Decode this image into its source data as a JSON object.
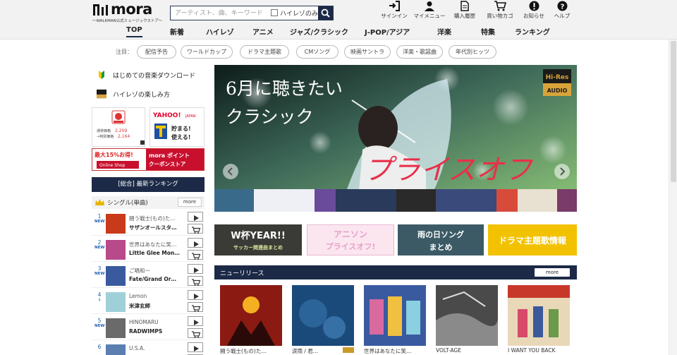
{
  "header": {
    "logo_text": "mora",
    "logo_tagline": "～WALKMAN公式ミュージックストア～",
    "search": {
      "placeholder": "アーティスト、曲、キーワード",
      "hires_only_label": "ハイレゾのみ"
    },
    "icons": [
      {
        "name": "signin-icon",
        "label": "サインイン"
      },
      {
        "name": "mymenu-icon",
        "label": "マイメニュー"
      },
      {
        "name": "history-icon",
        "label": "購入履歴"
      },
      {
        "name": "cart-icon",
        "label": "買い物カゴ"
      },
      {
        "name": "notice-icon",
        "label": "お知らせ"
      },
      {
        "name": "help-icon",
        "label": "ヘルプ"
      }
    ],
    "nav": [
      "TOP",
      "新着",
      "ハイレゾ",
      "アニメ",
      "ジャズ/クラシック",
      "J-POP/アジア",
      "洋楽",
      "特集",
      "ランキング"
    ]
  },
  "tags": {
    "label": "注目：",
    "items": [
      "配信予告",
      "ワールドカップ",
      "ドラマ主題歌",
      "CMソング",
      "映画サントラ",
      "洋楽・歌謡曲",
      "年代別ヒッツ"
    ]
  },
  "sidebar": {
    "links": [
      "はじめての音楽ダウンロード",
      "ハイレゾの楽しみ方"
    ],
    "banner_yahoo": {
      "brand": "YAHOO! JAPAN",
      "line1": "貯まる!",
      "line2": "使える!"
    },
    "banner_points": {
      "badge": "最大15%お得!",
      "title": "mora ポイント",
      "sub": "クーポンストア",
      "shop": "Online Shop"
    },
    "ranking_header": "[総合] 最新ランキング",
    "single_label": "シングル(単曲)",
    "more": "more",
    "ranking": [
      {
        "rank": "1",
        "new": "NEW",
        "title": "闘う戦士(もの)た…",
        "artist": "サザンオールスタ…",
        "color": "#c83a1a"
      },
      {
        "rank": "2",
        "new": "NEW",
        "title": "世界はあなたに笑…",
        "artist": "Little Glee Mon…",
        "color": "#b84a8a"
      },
      {
        "rank": "3",
        "new": "NEW",
        "title": "ご唱和ー",
        "artist": "Fate/Grand Or…",
        "color": "#3a5aa0"
      },
      {
        "rank": "4",
        "new": "↓",
        "title": "Lemon",
        "artist": "米津玄師",
        "color": "#9fd0d8"
      },
      {
        "rank": "5",
        "new": "NEW",
        "title": "HINOMARU",
        "artist": "RADWIMPS",
        "color": "#6a6a6a"
      },
      {
        "rank": "6",
        "new": "",
        "title": "U.S.A.",
        "artist": "",
        "color": "#5a7fb0"
      }
    ]
  },
  "hero": {
    "line1": "6月に聴きたい",
    "line2": "クラシック",
    "headline": "プライスオフ",
    "badge_top": "Hi-Res",
    "badge_bottom": "AUDIO"
  },
  "sub_banners": [
    {
      "line1": "W杯YEAR!!",
      "line2": "サッカー関連曲まとめ"
    },
    {
      "line1": "アニソン",
      "line2": "プライスオフ!"
    },
    {
      "line1": "雨の日ソング",
      "line2": "まとめ"
    },
    {
      "line1": "ドラマ主題歌情報",
      "line2": ""
    }
  ],
  "new_releases": {
    "title": "ニューリリース",
    "more": "more",
    "albums": [
      {
        "title": "闘う戦士(もの)た…",
        "hires": false
      },
      {
        "title": "涙雨 / 君…",
        "hires": true
      },
      {
        "title": "世界はあなたに笑…",
        "hires": false
      },
      {
        "title": "VOLT-AGE",
        "hires": false
      },
      {
        "title": "I WANT YOU BACK",
        "hires": false
      }
    ]
  }
}
